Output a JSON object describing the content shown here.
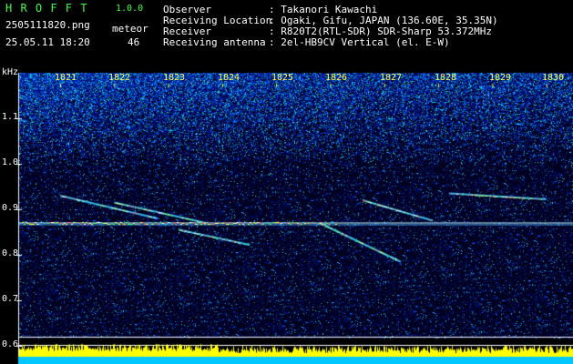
{
  "header": {
    "app_name": "H R O F F T",
    "version": "1.0.0",
    "filename": "2505111820.png",
    "mode": "meteor",
    "datetime": "25.05.11 18:20",
    "count": "46",
    "info": [
      {
        "label": "Observer",
        "value": ": Takanori Kawachi"
      },
      {
        "label": "Receiving Location",
        "value": ": Ogaki, Gifu, JAPAN (136.60E, 35.35N)"
      },
      {
        "label": "Receiver",
        "value": ": R820T2(RTL-SDR) SDR-Sharp 53.372MHz"
      },
      {
        "label": "Receiving antenna",
        "value": ": 2el-HB9CV Vertical (el. E-W)"
      }
    ]
  },
  "colors": {
    "header_green": "#3fff3f",
    "time_yellow": "#ffff5a",
    "baseline_blue": "#00c8ff",
    "baseline_yellow": "#ffff00"
  },
  "chart_data": {
    "type": "heatmap",
    "ylabel": "kHz",
    "y_ticks": [
      "1.1",
      "1.0",
      "0.9",
      "0.8",
      "0.7",
      "0.6"
    ],
    "x_ticks": [
      "1821",
      "1822",
      "1823",
      "1824",
      "1825",
      "1826",
      "1827",
      "1828",
      "1829",
      "1830"
    ],
    "carrier_khz": 0.87,
    "traces": [
      {
        "from": [
          "1821",
          0.93
        ],
        "to": [
          "1822.8",
          0.88
        ]
      },
      {
        "from": [
          "1822",
          0.915
        ],
        "to": [
          "1823.7",
          0.87
        ]
      },
      {
        "from": [
          "1825.8",
          0.87
        ],
        "to": [
          "1827.3",
          0.785
        ]
      },
      {
        "from": [
          "1826.6",
          0.92
        ],
        "to": [
          "1827.9",
          0.875
        ]
      },
      {
        "from": [
          "1828.2",
          0.935
        ],
        "to": [
          "1830",
          0.922
        ]
      },
      {
        "from": [
          "1823.2",
          0.855
        ],
        "to": [
          "1824.5",
          0.822
        ]
      }
    ]
  }
}
